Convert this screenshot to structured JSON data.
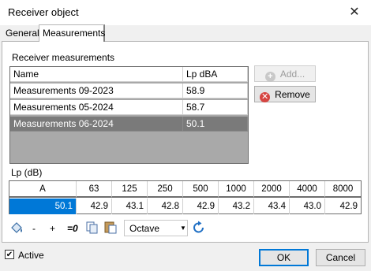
{
  "window": {
    "title": "Receiver object",
    "close_glyph": "✕"
  },
  "tabs": [
    {
      "label": "General"
    },
    {
      "label": "Measurements"
    }
  ],
  "receiver_measurements": {
    "label": "Receiver measurements",
    "columns": [
      "Name",
      "Lp dBA"
    ],
    "rows": [
      {
        "name": "Measurements 09-2023",
        "value": "58.9"
      },
      {
        "name": "Measurements 05-2024",
        "value": "58.7"
      },
      {
        "name": "Measurements 06-2024",
        "value": "50.1"
      }
    ],
    "selected_row": 2
  },
  "buttons": {
    "add": "Add...",
    "remove": "Remove",
    "ok": "OK",
    "cancel": "Cancel"
  },
  "lp": {
    "label": "Lp (dB)",
    "headers": [
      "A",
      "63",
      "125",
      "250",
      "500",
      "1000",
      "2000",
      "4000",
      "8000"
    ],
    "values": [
      "50.1",
      "42.9",
      "43.1",
      "42.8",
      "42.9",
      "43.2",
      "43.4",
      "43.0",
      "42.9"
    ]
  },
  "toolbar": {
    "minus": "-",
    "plus": "+",
    "zero": "=0",
    "band": "Octave"
  },
  "active": {
    "label": "Active",
    "checked": true
  },
  "colors": {
    "selection": "#0078d7",
    "selected_row": "#7a7a7a",
    "remove_icon": "#d64541"
  }
}
